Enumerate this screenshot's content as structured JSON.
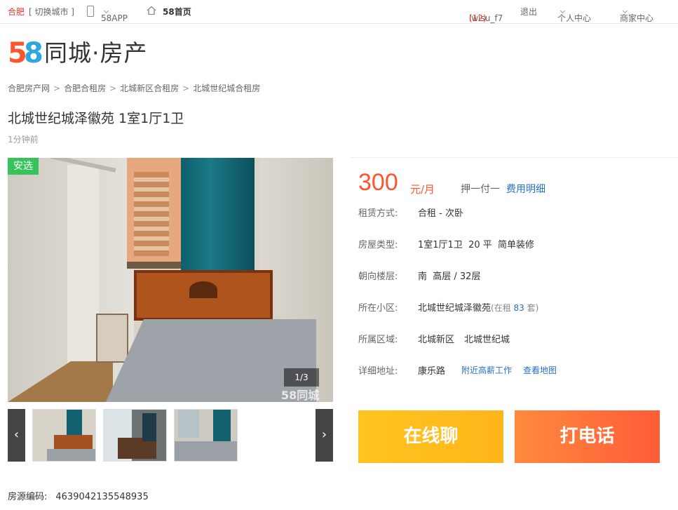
{
  "topbar": {
    "city": "合肥",
    "switch_city": "[ 切换城市 ]",
    "app": "58APP",
    "home": "58首页",
    "username": "lwisu_f7",
    "message_count": "(12)",
    "logout": "退出",
    "personal_center": "个人中心",
    "merchant_center": "商家中心"
  },
  "logo": {
    "num5": "5",
    "num8": "8",
    "brand": "同城·房产"
  },
  "breadcrumb": [
    "合肥房产网",
    "合肥合租房",
    "北城新区合租房",
    "北城世纪城合租房"
  ],
  "listing": {
    "title": "北城世纪城泽徽苑 1室1厅1卫",
    "posted": "1分钟前",
    "tag": "安选",
    "photo_counter": "1/3",
    "watermark": "58同城"
  },
  "price": {
    "amount": "300",
    "unit": "元/月",
    "payment": "押一付一",
    "fee_detail": "费用明细"
  },
  "details": {
    "rent_type_label": "租赁方式:",
    "rent_type": "合租 - 次卧",
    "house_type_label": "房屋类型:",
    "house_type": "1室1厅1卫  20 平  简单装修",
    "orientation_label": "朝向楼层:",
    "orientation": "南  高层 / 32层",
    "community_label": "所在小区:",
    "community": "北城世纪城泽徽苑",
    "community_rent_prefix": "(在租 ",
    "community_rent_count": "83",
    "community_rent_suffix": " 套)",
    "district_label": "所属区域:",
    "district": "北城新区",
    "subdistrict": "北城世纪城",
    "address_label": "详细地址:",
    "address": "康乐路",
    "nearby_jobs": "附近高薪工作",
    "view_map": "查看地图"
  },
  "actions": {
    "chat": "在线聊",
    "call": "打电话"
  },
  "listing_code": {
    "label": "房源编码:",
    "value": "4639042135548935"
  },
  "arrows": {
    "prev": "‹",
    "next": "›"
  },
  "colors": {
    "accent": "#ff552e",
    "link": "#2a6fc9",
    "tag": "#36c35b"
  }
}
